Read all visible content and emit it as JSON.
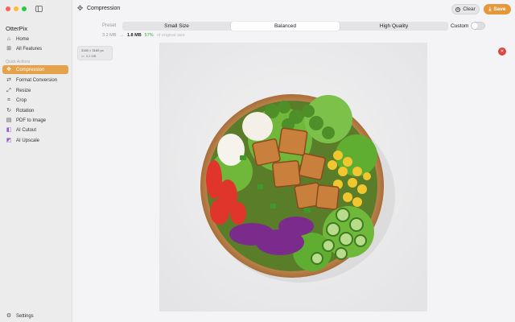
{
  "app": {
    "name": "OtterPix"
  },
  "sidebar": {
    "top_items": [
      {
        "label": "Home",
        "icon": "home-icon"
      },
      {
        "label": "All Features",
        "icon": "grid-icon"
      }
    ],
    "section_label": "Quick Actions",
    "tools": [
      {
        "label": "Compression",
        "icon": "compress-icon",
        "active": true
      },
      {
        "label": "Format Conversion",
        "icon": "convert-icon"
      },
      {
        "label": "Resize",
        "icon": "resize-icon"
      },
      {
        "label": "Crop",
        "icon": "crop-icon"
      },
      {
        "label": "Rotation",
        "icon": "rotate-icon"
      },
      {
        "label": "PDF to Image",
        "icon": "pdf-icon"
      },
      {
        "label": "AI Cutout",
        "icon": "ai-cutout-icon"
      },
      {
        "label": "AI Upscale",
        "icon": "ai-upscale-icon"
      }
    ],
    "settings_label": "Settings"
  },
  "toolbar": {
    "title": "Compression",
    "clear_label": "Clear",
    "save_label": "Save"
  },
  "preset": {
    "label": "Preset",
    "options": [
      "Small Size",
      "Balanced",
      "High Quality"
    ],
    "selected": "Balanced",
    "custom_label": "Custom",
    "custom_enabled": false
  },
  "stats": {
    "original_size": "3.2 MB",
    "arrow": "→",
    "new_size": "1.8 MB",
    "percent": "57%",
    "suffix": "of original size"
  },
  "image_info": {
    "dimensions": "3160 × 3160 px",
    "file_size": "3.2 MB"
  },
  "colors": {
    "accent": "#e5a24a",
    "save": "#e5973a",
    "close": "#e0433a",
    "percent": "#3fa64a"
  }
}
